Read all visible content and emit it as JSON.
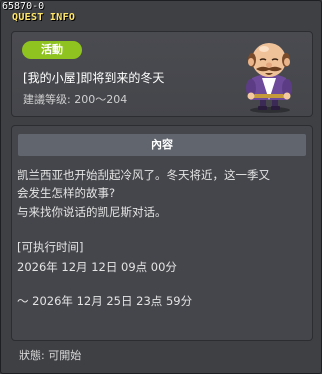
{
  "window": {
    "id_label": "65870-0",
    "title": "QUEST INFO"
  },
  "header": {
    "badge": "活動",
    "quest_name": "[我的小屋]即将到来的冬天",
    "level_text": "建議等级: 200～204",
    "npc_icon": "bald-mustached-npc-portrait-icon"
  },
  "content": {
    "section_title": "內容",
    "description_lines": [
      "凯兰西亚也开始刮起冷风了。冬天将近，这一季又",
      "会发生怎样的故事?",
      "与来找你说话的凯尼斯对话。"
    ],
    "time_label": "[可执行时间]",
    "start_time": "2026年 12月 12日 09点 00分",
    "end_time": "～ 2026年 12月 25日 23点 59分"
  },
  "status": {
    "text": "狀態: 可開始"
  },
  "colors": {
    "badge_green": "#8fc31f",
    "title_yellow": "#ffe66a",
    "section_header": "#61666e"
  }
}
